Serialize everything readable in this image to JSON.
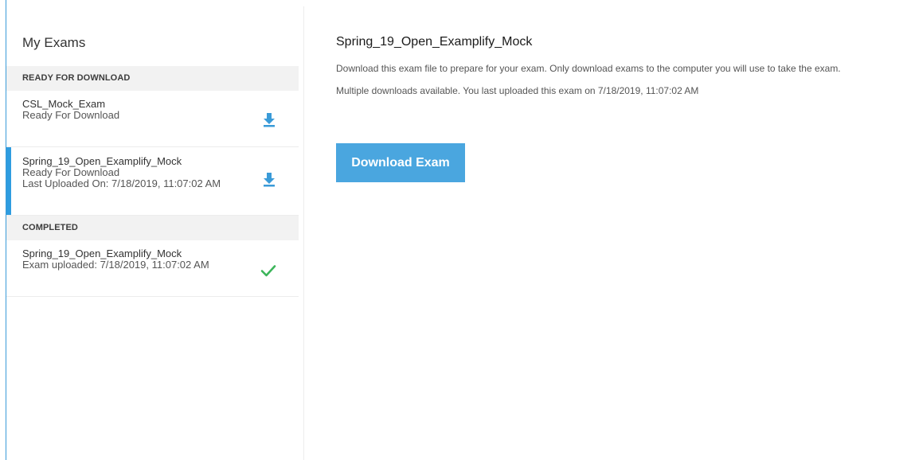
{
  "sidebar": {
    "title": "My Exams",
    "sections": [
      {
        "header": "READY FOR DOWNLOAD",
        "items": [
          {
            "name": "CSL_Mock_Exam",
            "status": "Ready For Download",
            "icon": "download-icon"
          },
          {
            "name": "Spring_19_Open_Examplify_Mock",
            "status": "Ready For Download",
            "detail": "Last Uploaded On: 7/18/2019, 11:07:02 AM",
            "icon": "download-icon",
            "selected": true
          }
        ]
      },
      {
        "header": "COMPLETED",
        "items": [
          {
            "name": "Spring_19_Open_Examplify_Mock",
            "status": "Exam uploaded: 7/18/2019, 11:07:02 AM",
            "icon": "checkmark-icon"
          }
        ]
      }
    ]
  },
  "main": {
    "title": "Spring_19_Open_Examplify_Mock",
    "description": "Download this exam file to prepare for your exam. Only download exams to the computer you will use to take the exam.",
    "info": "Multiple downloads available. You last uploaded this exam on 7/18/2019, 11:07:02 AM",
    "download_button": "Download Exam"
  },
  "colors": {
    "accent": "#4aa6df",
    "selected_bar": "#2e9ce0",
    "success": "#3cb55a",
    "section_bg": "#f2f2f2"
  }
}
